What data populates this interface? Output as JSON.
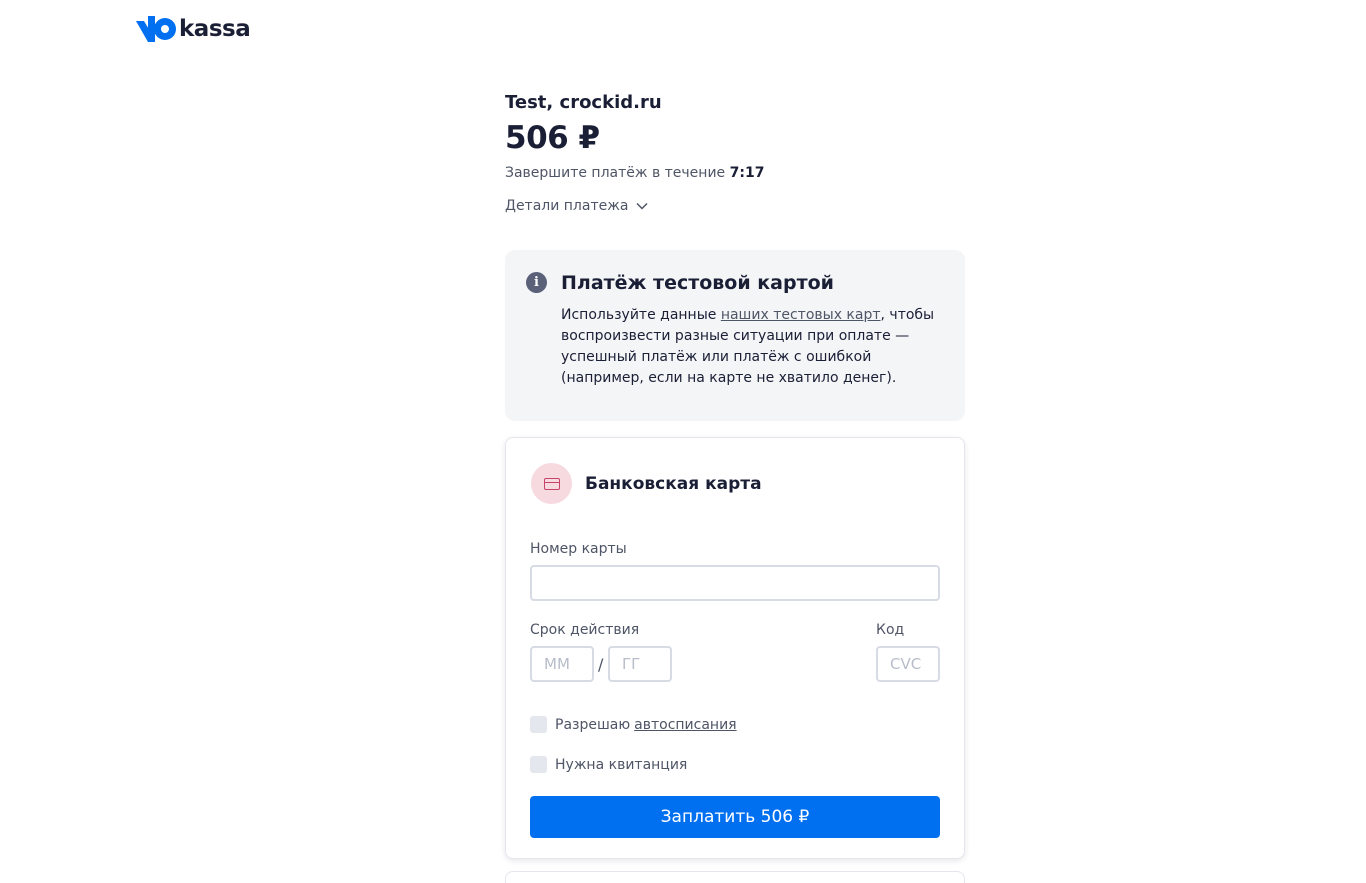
{
  "header": {
    "logo_text": "kassa",
    "logo_mark_icon": "yoomoney-logo-icon",
    "brand_color": "#0070f0"
  },
  "payment": {
    "merchant": "Test, crockid.ru",
    "amount": "506 ₽",
    "timer_prefix": "Завершите платёж в течение",
    "timer_value": "7:17",
    "details_label": "Детали платежа",
    "details_icon": "chevron-down-icon"
  },
  "info": {
    "icon": "info-icon",
    "title": "Платёж тестовой картой",
    "body_before_link": "Используйте данные ",
    "link_text": "наших тестовых карт",
    "body_after_link": ", чтобы воспроизвести разные ситуации при оплате — успешный платёж или платёж с ошибкой (например, если на карте не хватило денег)."
  },
  "card_form": {
    "method_icon": "credit-card-icon",
    "method_title": "Банковская карта",
    "card_number_label": "Номер карты",
    "card_number_value": "",
    "expiry_label": "Срок действия",
    "month_placeholder": "ММ",
    "year_placeholder": "ГГ",
    "separator": "/",
    "cvc_label": "Код",
    "cvc_placeholder": "CVC",
    "autopay_text": "Разрешаю",
    "autopay_link": "автосписания",
    "receipt_text": "Нужна квитанция",
    "pay_button": "Заплатить 506 ₽"
  },
  "colors": {
    "primary_button": "#0070f0",
    "card_icon_bg": "#f7d9e0",
    "info_bg": "#f4f5f7"
  }
}
